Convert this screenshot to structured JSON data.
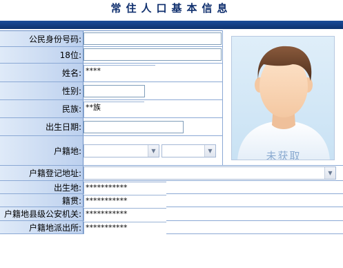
{
  "title": "常住人口基本信息",
  "fields": {
    "id_number": {
      "label": "公民身份号码:",
      "value": ""
    },
    "id18": {
      "label": "18位:",
      "value": ""
    },
    "name": {
      "label": "姓名:",
      "value": "****"
    },
    "gender": {
      "label": "性别:",
      "value": ""
    },
    "ethnicity": {
      "label": "民族:",
      "value": "**族"
    },
    "birth_date": {
      "label": "出生日期:",
      "value": ""
    },
    "household_place": {
      "label": "户籍地:",
      "value_province": "",
      "value_city": ""
    },
    "household_address": {
      "label": "户籍登记地址:",
      "value": ""
    },
    "birthplace": {
      "label": "出生地:",
      "value": "***********"
    },
    "native_place": {
      "label": "籍贯:",
      "value": "***********"
    },
    "county_police": {
      "label": "户籍地县级公安机关:",
      "value": "***********"
    },
    "police_station": {
      "label": "户籍地派出所:",
      "value": "***********"
    }
  },
  "photo": {
    "caption": "未获取"
  },
  "colors": {
    "header_bar": "#0d326e",
    "label_bg": "#bcd0ee",
    "border": "#8aa8d4"
  }
}
